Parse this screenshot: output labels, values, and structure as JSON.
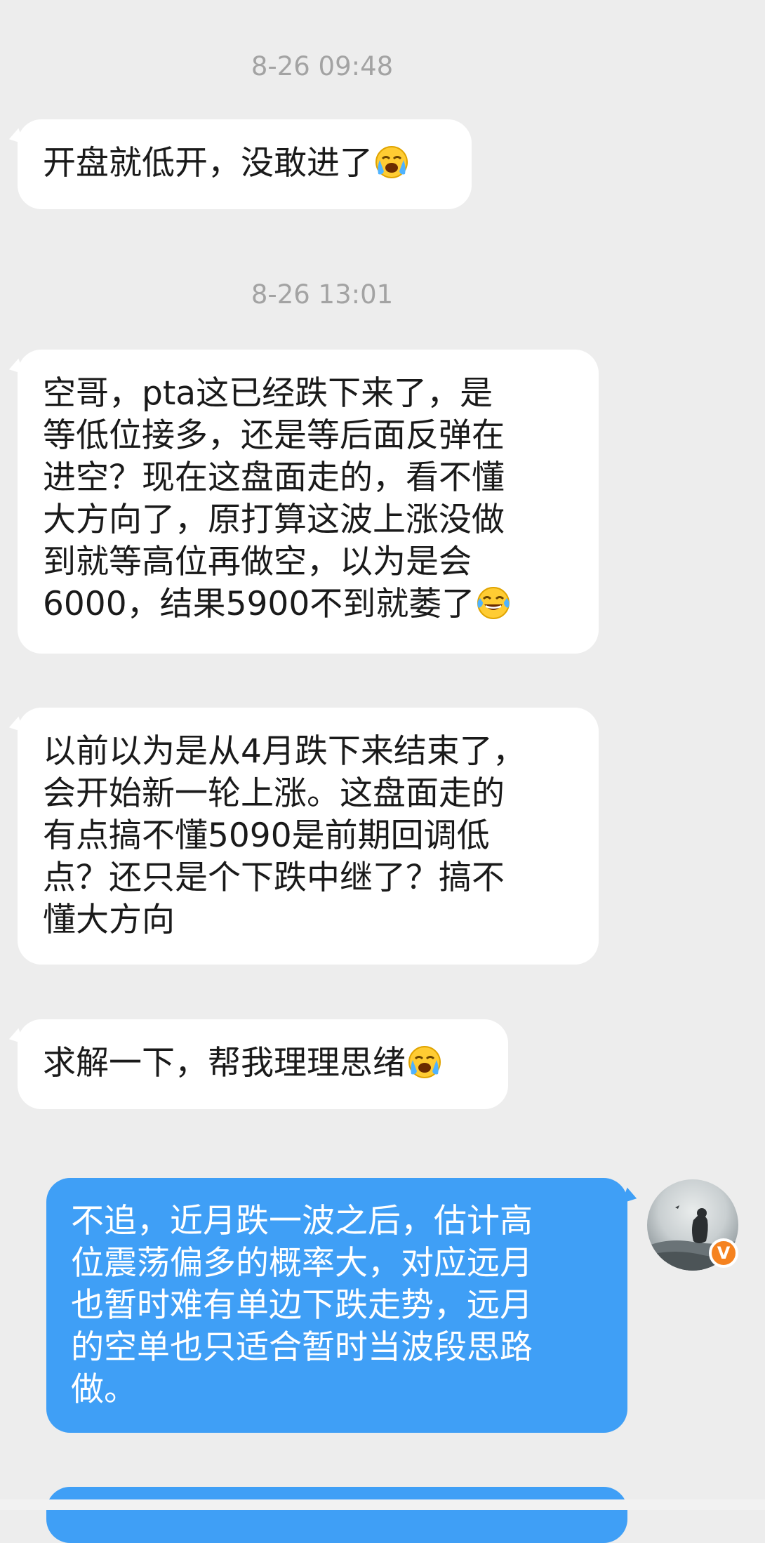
{
  "chat": {
    "messages": [
      {
        "timestamp": "8-26 09:48",
        "side": "incoming",
        "text": "开盘就低开，没敢进了",
        "emoji": "loudly-crying-face"
      },
      {
        "timestamp": "8-26 13:01",
        "side": "incoming",
        "text": "空哥，pta这已经跌下来了，是\n等低位接多，还是等后面反弹在\n进空？现在这盘面走的，看不懂\n大方向了，原打算这波上涨没做\n到就等高位再做空，以为是会\n6000，结果5900不到就萎了",
        "emoji": "face-with-tears-of-joy"
      },
      {
        "side": "incoming",
        "text": "以前以为是从4月跌下来结束了，\n会开始新一轮上涨。这盘面走的\n有点搞不懂5090是前期回调低\n点？还只是个下跌中继了？搞不\n懂大方向"
      },
      {
        "side": "incoming",
        "text": "求解一下，帮我理理思绪",
        "emoji": "loudly-crying-face"
      },
      {
        "side": "outgoing",
        "text": "不追，近月跌一波之后，估计高\n位震荡偏多的概率大，对应远月\n也暂时难有单边下跌走势，远月\n的空单也只适合暂时当波段思路\n做。"
      }
    ],
    "avatar_badge": "V"
  },
  "colors": {
    "background": "#ededed",
    "incoming_bubble": "#ffffff",
    "outgoing_bubble": "#3f9ff6",
    "timestamp_text": "#a3a3a3",
    "badge": "#f5821f"
  }
}
